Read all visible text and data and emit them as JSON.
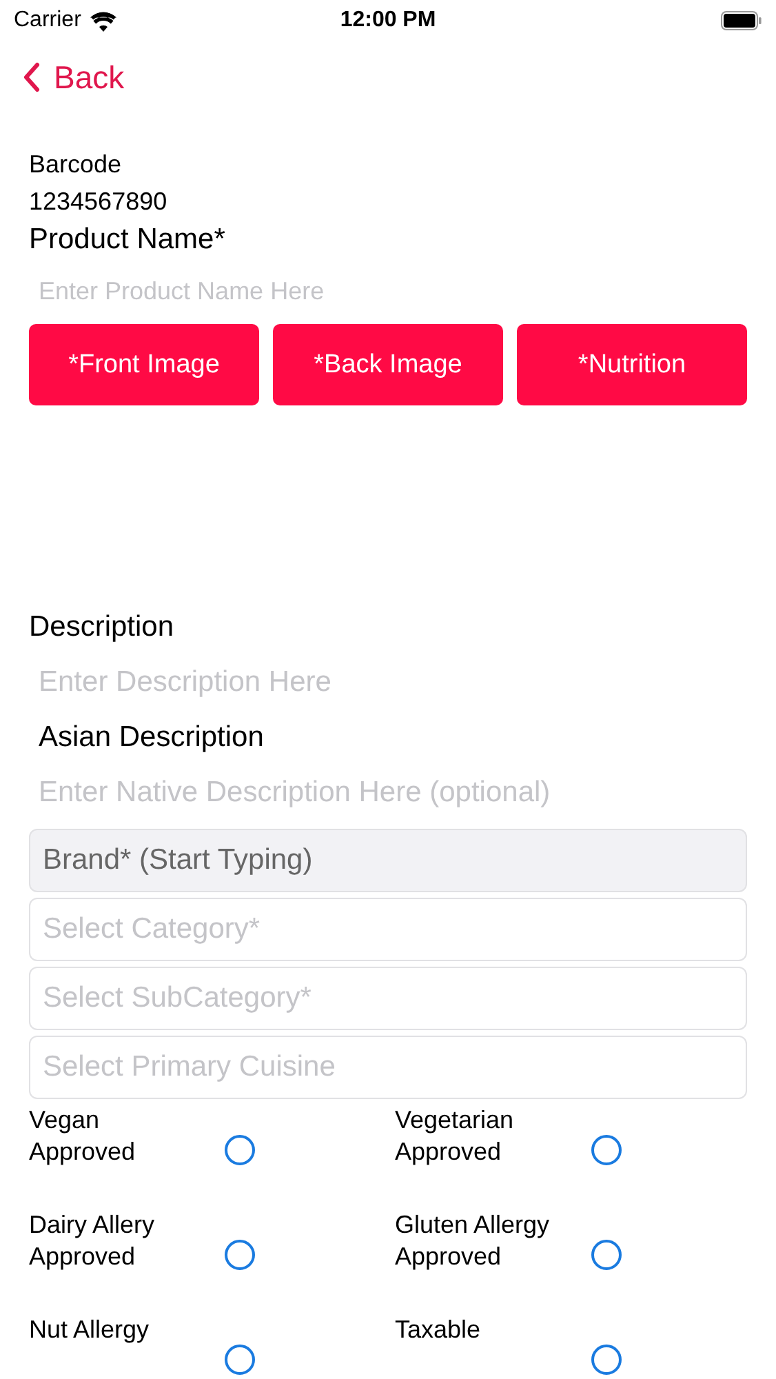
{
  "status_bar": {
    "carrier": "Carrier",
    "time": "12:00 PM"
  },
  "nav": {
    "back": "Back"
  },
  "barcode": {
    "label": "Barcode",
    "value": "1234567890"
  },
  "product_name": {
    "label": "Product Name*",
    "placeholder": "Enter Product Name Here"
  },
  "image_buttons": [
    "*Front Image",
    "*Back Image",
    "*Nutrition"
  ],
  "description": {
    "label": "Description",
    "placeholder": "Enter Description Here"
  },
  "asian_description": {
    "label": "Asian Description",
    "placeholder": "Enter Native Description Here (optional)"
  },
  "selects": [
    {
      "placeholder": "Brand* (Start Typing)",
      "disabled": true
    },
    {
      "placeholder": "Select Category*",
      "disabled": false
    },
    {
      "placeholder": "Select SubCategory*",
      "disabled": false
    },
    {
      "placeholder": "Select Primary Cuisine",
      "disabled": false
    }
  ],
  "options": [
    {
      "label": "Vegan\nApproved",
      "checked": false
    },
    {
      "label": "Vegetarian\nApproved",
      "checked": false
    },
    {
      "label": "Dairy Allery\nApproved",
      "checked": false
    },
    {
      "label": "Gluten Allergy\nApproved",
      "checked": false
    },
    {
      "label": "Nut Allergy",
      "checked": false
    },
    {
      "label": "Taxable",
      "checked": false
    }
  ]
}
